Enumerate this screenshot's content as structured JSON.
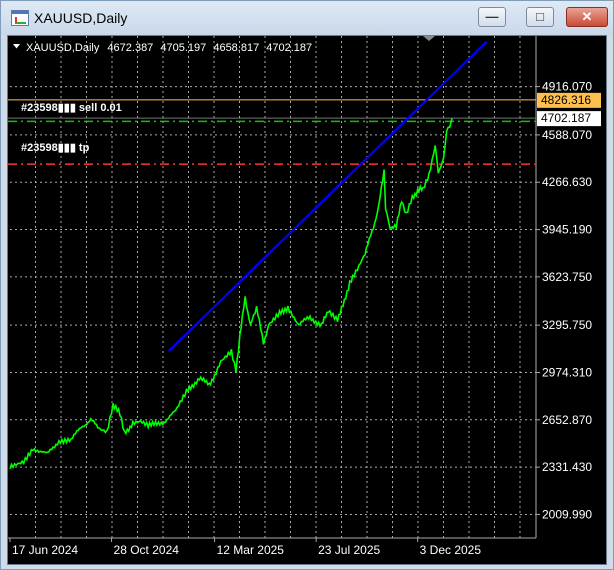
{
  "window": {
    "title": "XAUUSD,Daily"
  },
  "controls": {
    "minimize": "—",
    "maximize": "□",
    "close": "✕"
  },
  "header": {
    "symbol": "XAUUSD,Daily",
    "open": "4672.387",
    "high": "4705.197",
    "low": "4658.817",
    "close": "4702.187"
  },
  "orders": {
    "sell_label": "#23598▮▮▮ sell 0.01",
    "tp_label": "#23598▮▮▮ tp"
  },
  "price_labels": {
    "sell_level": "4826.316",
    "current": "4702.187"
  },
  "colors": {
    "background": "#000000",
    "grid": "#aaaaaa",
    "price_line": "#00ff00",
    "trend_line": "#0000ff",
    "sell_level": "#ffc04d",
    "green_dashed": "#00cc00",
    "red_dashed": "#ff3333"
  },
  "chart_data": {
    "type": "line",
    "y_ticks": [
      "4916.070",
      "4588.070",
      "4266.630",
      "3945.190",
      "3623.750",
      "3295.750",
      "2974.310",
      "2652.870",
      "2331.430",
      "2009.990"
    ],
    "x_ticks": [
      "17 Jun 2024",
      "28 Oct 2024",
      "12 Mar 2025",
      "23 Jul 2025",
      "3 Dec 2025"
    ],
    "ylim": [
      1850,
      5260
    ],
    "xlim": [
      "2024-06-17",
      "2026-05-07"
    ],
    "series": [
      {
        "points": [
          [
            "2024-06-17",
            2330
          ],
          [
            "2024-07-05",
            2370
          ],
          [
            "2024-07-17",
            2460
          ],
          [
            "2024-08-05",
            2420
          ],
          [
            "2024-08-20",
            2510
          ],
          [
            "2024-09-05",
            2520
          ],
          [
            "2024-09-20",
            2610
          ],
          [
            "2024-10-01",
            2650
          ],
          [
            "2024-10-12",
            2600
          ],
          [
            "2024-10-22",
            2580
          ],
          [
            "2024-10-30",
            2760
          ],
          [
            "2024-11-08",
            2690
          ],
          [
            "2024-11-14",
            2560
          ],
          [
            "2024-11-25",
            2630
          ],
          [
            "2024-12-05",
            2640
          ],
          [
            "2024-12-15",
            2610
          ],
          [
            "2025-01-05",
            2640
          ],
          [
            "2025-01-20",
            2710
          ],
          [
            "2025-02-05",
            2860
          ],
          [
            "2025-02-20",
            2930
          ],
          [
            "2025-03-05",
            2900
          ],
          [
            "2025-03-12",
            2940
          ],
          [
            "2025-03-20",
            3040
          ],
          [
            "2025-03-28",
            3080
          ],
          [
            "2025-04-03",
            3110
          ],
          [
            "2025-04-09",
            2980
          ],
          [
            "2025-04-14",
            3220
          ],
          [
            "2025-04-21",
            3480
          ],
          [
            "2025-04-28",
            3300
          ],
          [
            "2025-05-06",
            3410
          ],
          [
            "2025-05-15",
            3180
          ],
          [
            "2025-05-22",
            3290
          ],
          [
            "2025-06-05",
            3370
          ],
          [
            "2025-06-16",
            3420
          ],
          [
            "2025-06-30",
            3300
          ],
          [
            "2025-07-15",
            3350
          ],
          [
            "2025-07-30",
            3290
          ],
          [
            "2025-08-08",
            3400
          ],
          [
            "2025-08-20",
            3340
          ],
          [
            "2025-08-29",
            3450
          ],
          [
            "2025-09-05",
            3590
          ],
          [
            "2025-09-15",
            3680
          ],
          [
            "2025-09-25",
            3780
          ],
          [
            "2025-10-06",
            3960
          ],
          [
            "2025-10-13",
            4100
          ],
          [
            "2025-10-20",
            4350
          ],
          [
            "2025-10-22",
            4100
          ],
          [
            "2025-10-28",
            3960
          ],
          [
            "2025-11-05",
            3980
          ],
          [
            "2025-11-12",
            4130
          ],
          [
            "2025-11-18",
            4040
          ],
          [
            "2025-11-26",
            4160
          ],
          [
            "2025-12-03",
            4210
          ],
          [
            "2025-12-10",
            4220
          ],
          [
            "2025-12-18",
            4320
          ],
          [
            "2025-12-26",
            4520
          ],
          [
            "2025-12-30",
            4340
          ],
          [
            "2026-01-06",
            4420
          ],
          [
            "2026-01-10",
            4610
          ],
          [
            "2026-01-14",
            4640
          ],
          [
            "2026-01-17",
            4700
          ]
        ]
      }
    ],
    "trend_line": [
      [
        "2025-01-11",
        3120
      ],
      [
        "2026-03-03",
        5220
      ]
    ],
    "horizontal_levels": [
      4826.316,
      4702.187,
      4390
    ]
  }
}
